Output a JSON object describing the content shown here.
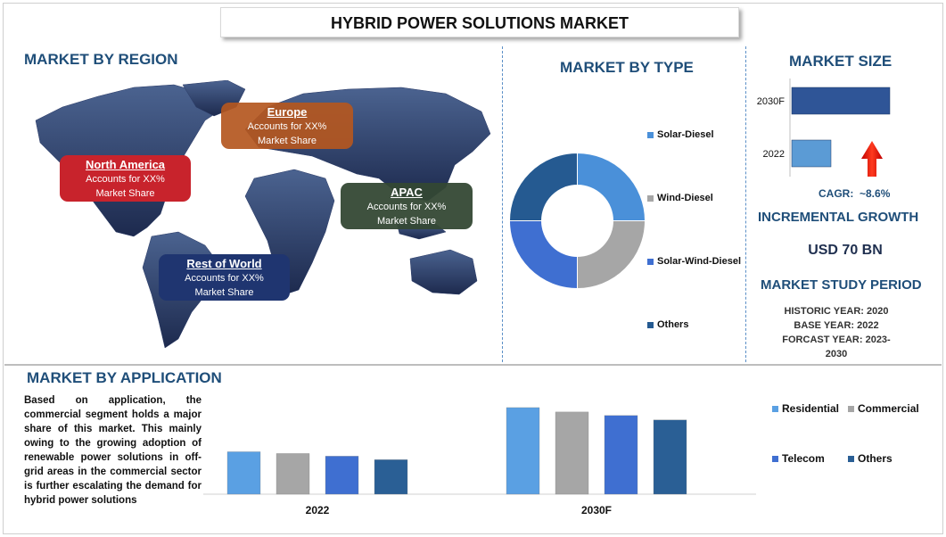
{
  "title": "HYBRID POWER SOLUTIONS MARKET",
  "region": {
    "title": "MARKET BY REGION",
    "boxes": [
      {
        "name": "North America",
        "line1": "Accounts for XX%",
        "line2": "Market Share",
        "color": "#c8232c"
      },
      {
        "name": "Europe",
        "line1": "Accounts for XX%",
        "line2": "Market Share",
        "color": "#b4571f"
      },
      {
        "name": "APAC",
        "line1": "Accounts for XX%",
        "line2": "Market Share",
        "color": "#3a4f3c"
      },
      {
        "name": "Rest of World",
        "line1": "Accounts for XX%",
        "line2": "Market Share",
        "color": "#1f3570"
      }
    ]
  },
  "type": {
    "title": "MARKET BY TYPE",
    "legend": [
      "Solar-Diesel",
      "Wind-Diesel",
      "Solar-Wind-Diesel",
      "Others"
    ]
  },
  "size": {
    "title": "MARKET SIZE",
    "cagr_label": "CAGR:",
    "cagr_value": "~8.6%"
  },
  "growth": {
    "title": "INCREMENTAL GROWTH",
    "value": "USD 70 BN"
  },
  "study": {
    "title": "MARKET STUDY PERIOD",
    "historic": "HISTORIC YEAR: 2020",
    "base": "BASE YEAR: 2022",
    "forecast_a": "FORCAST YEAR: 2023-",
    "forecast_b": "2030"
  },
  "application": {
    "title": "MARKET BY APPLICATION",
    "description": "Based on application, the commercial segment holds a major share of this market. This mainly owing to the growing adoption of renewable power solutions in off-grid areas in the commercial sector is further escalating the demand for hybrid power solutions"
  },
  "chart_data": [
    {
      "type": "pie",
      "categories": [
        "Solar-Diesel",
        "Wind-Diesel",
        "Solar-Wind-Diesel",
        "Others"
      ],
      "values": [
        25,
        25,
        25,
        25
      ],
      "colors": [
        "#4a90d9",
        "#a6a6a6",
        "#3f6fd1",
        "#255a91"
      ],
      "donut": true,
      "legend": "right"
    },
    {
      "type": "bar",
      "orientation": "horizontal",
      "categories": [
        "2030F",
        "2022"
      ],
      "values": [
        100,
        40
      ],
      "colors": [
        "#2f5597",
        "#5b9bd5"
      ]
    },
    {
      "type": "bar",
      "categories": [
        "2022",
        "2030F"
      ],
      "series": [
        {
          "name": "Residential",
          "values": [
            48,
            98
          ],
          "color": "#5aa0e3"
        },
        {
          "name": "Commercial",
          "values": [
            46,
            93
          ],
          "color": "#a6a6a6"
        },
        {
          "name": "Telecom",
          "values": [
            43,
            89
          ],
          "color": "#3f6fd1"
        },
        {
          "name": "Others",
          "values": [
            39,
            84
          ],
          "color": "#2a5f95"
        }
      ],
      "ylim": [
        0,
        105
      ],
      "legend": "right"
    }
  ]
}
